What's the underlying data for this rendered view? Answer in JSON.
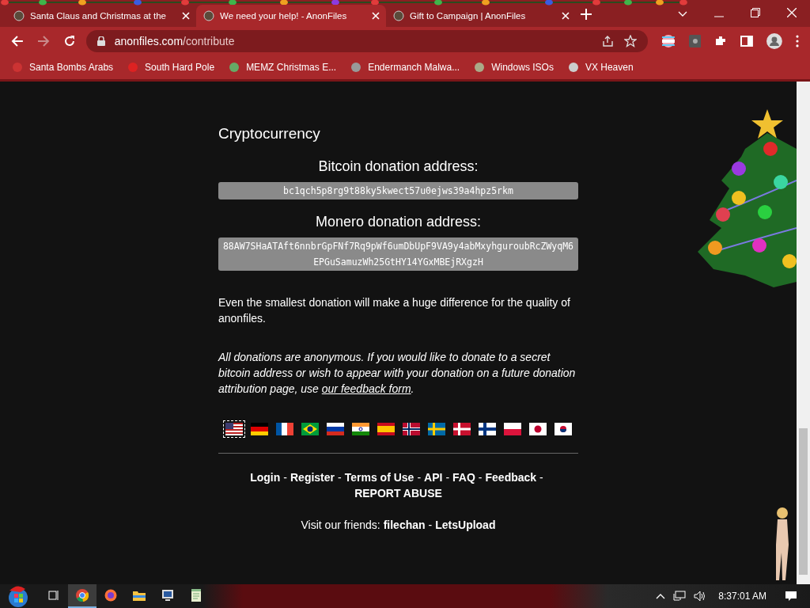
{
  "tabs": [
    {
      "title": "Santa Claus and Christmas at the",
      "selected": false
    },
    {
      "title": "We need your help! - AnonFiles",
      "selected": true
    },
    {
      "title": "Gift to Campaign | AnonFiles",
      "selected": false
    }
  ],
  "address_bar": {
    "host": "anonfiles.com",
    "path": "/contribute"
  },
  "bookmarks": [
    "Santa Bombs Arabs",
    "South Hard Pole",
    "MEMZ Christmas E...",
    "Endermanch Malwa...",
    "Windows ISOs",
    "VX Heaven"
  ],
  "page": {
    "heading": "Cryptocurrency",
    "addresses": [
      {
        "label": "Bitcoin donation address:",
        "value": "bc1qch5p8rg9t88ky5kwect57u0ejws39a4hpz5rkm"
      },
      {
        "label": "Monero donation address:",
        "value": "88AW7SHaATAft6nnbrGpFNf7Rq9pWf6umDbUpF9VA9y4abMxyhguroubRcZWyqM6EPGuSamuzWh25GtHY14YGxMBEjRXgzH"
      }
    ],
    "note": "Even the smallest donation will make a huge difference for the quality of anonfiles.",
    "anon_note": {
      "text": "All donations are anonymous. If you would like to donate to a secret bitcoin address or wish to appear with your donation on a future donation attribution page, use ",
      "link": "our feedback form",
      "end": "."
    },
    "flags": [
      {
        "kind": "us",
        "selected": true
      },
      {
        "kind": "de",
        "selected": false
      },
      {
        "kind": "fr",
        "selected": false
      },
      {
        "kind": "br",
        "selected": false
      },
      {
        "kind": "ru",
        "selected": false
      },
      {
        "kind": "in",
        "selected": false
      },
      {
        "kind": "es",
        "selected": false
      },
      {
        "kind": "no",
        "selected": false
      },
      {
        "kind": "se",
        "selected": false
      },
      {
        "kind": "dk",
        "selected": false
      },
      {
        "kind": "fi",
        "selected": false
      },
      {
        "kind": "pl",
        "selected": false
      },
      {
        "kind": "jp",
        "selected": false
      },
      {
        "kind": "kr",
        "selected": false
      }
    ],
    "footer_links": [
      {
        "text": "Login",
        "sep": "-"
      },
      {
        "text": "Register",
        "sep": "-"
      },
      {
        "text": "Terms of Use",
        "sep": "-"
      },
      {
        "text": "API",
        "sep": "-"
      },
      {
        "text": "FAQ",
        "sep": "-"
      },
      {
        "text": "Feedback",
        "sep": "-"
      },
      {
        "text": "REPORT ABUSE"
      }
    ],
    "friends": {
      "label": "Visit our friends:",
      "links": [
        {
          "text": "filechan",
          "sep": "-"
        },
        {
          "text": "LetsUpload"
        }
      ]
    }
  },
  "taskbar": {
    "apps": [
      {
        "kind": "taskview",
        "running": false
      },
      {
        "kind": "chrome",
        "running": true
      },
      {
        "kind": "firefox",
        "running": false
      },
      {
        "kind": "folder",
        "running": false
      },
      {
        "kind": "monitor",
        "running": false
      },
      {
        "kind": "notepad",
        "running": false
      }
    ],
    "clock": "8:37:01 AM"
  }
}
